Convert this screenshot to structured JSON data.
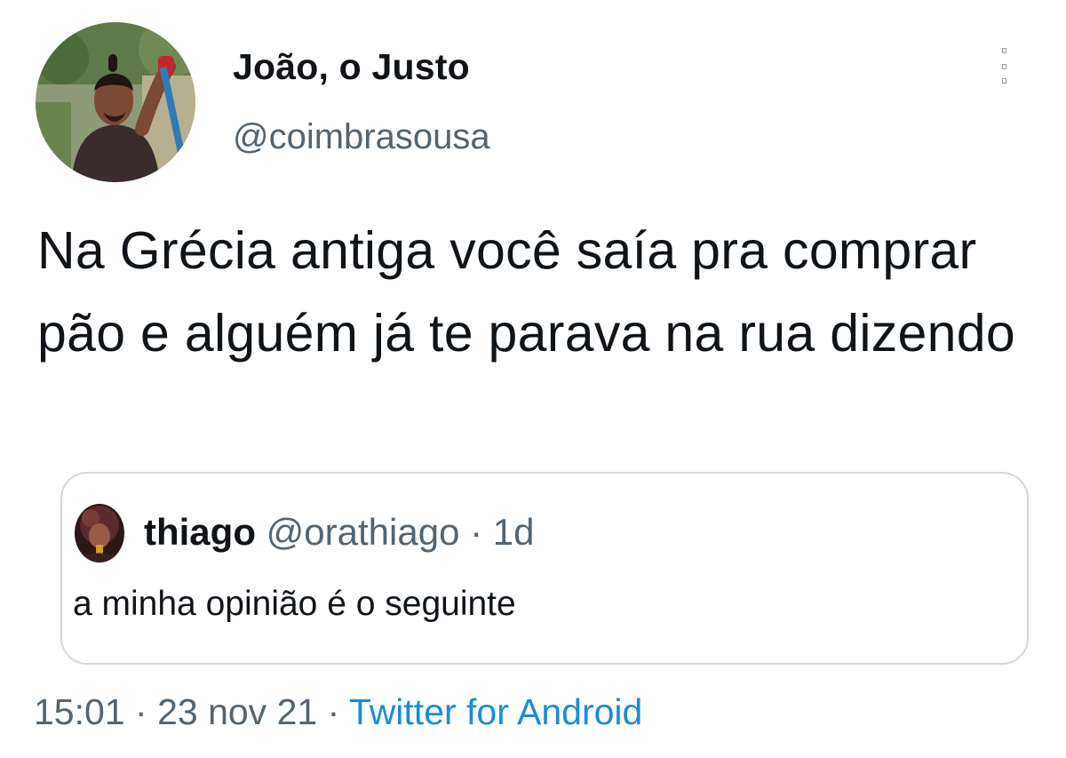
{
  "author": {
    "display_name": "João, o Justo",
    "handle": "@coimbrasousa"
  },
  "tweet": {
    "text": "Na Grécia antiga você saía pra comprar pão e alguém já te parava na rua dizendo"
  },
  "quoted_tweet": {
    "name": "thiago",
    "handle": "@orathiago",
    "separator": "·",
    "age": "1d",
    "text": "a minha opinião é o seguinte"
  },
  "footer": {
    "time": "15:01",
    "separator": "·",
    "date": "23 nov 21",
    "source": "Twitter for Android"
  },
  "icons": {
    "more": "more-options-icon"
  },
  "colors": {
    "text_primary": "#0f1419",
    "text_secondary": "#536471",
    "link": "#1a8cd8",
    "card_border": "#cfd9de"
  }
}
